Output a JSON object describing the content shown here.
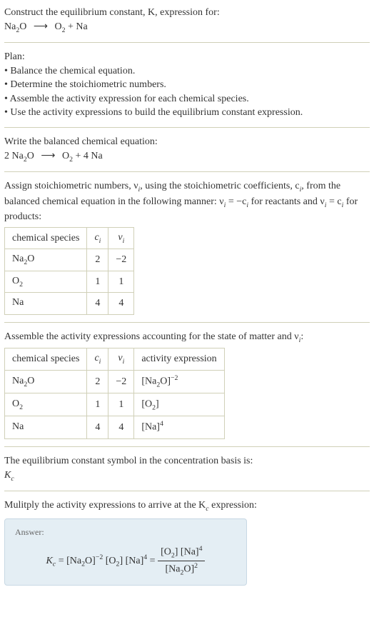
{
  "intro": {
    "line1": "Construct the equilibrium constant, K, expression for:",
    "eq_lhs": "Na",
    "eq_lhs_sub": "2",
    "eq_lhs2": "O",
    "eq_rhs1": "O",
    "eq_rhs1_sub": "2",
    "eq_rhs2": "Na"
  },
  "plan": {
    "title": "Plan:",
    "items": [
      "• Balance the chemical equation.",
      "• Determine the stoichiometric numbers.",
      "• Assemble the activity expression for each chemical species.",
      "• Use the activity expressions to build the equilibrium constant expression."
    ]
  },
  "balanced": {
    "title": "Write the balanced chemical equation:",
    "c1": "2 Na",
    "c1_sub": "2",
    "c1b": "O",
    "c2": "O",
    "c2_sub": "2",
    "c3": "4 Na"
  },
  "stoich": {
    "intro1": "Assign stoichiometric numbers, ν",
    "intro1_sub": "i",
    "intro2": ", using the stoichiometric coefficients, c",
    "intro2_sub": "i",
    "intro3": ", from the balanced chemical equation in the following manner: ν",
    "intro3_sub": "i",
    "intro4": " = −c",
    "intro4_sub": "i",
    "intro5": " for reactants and ν",
    "intro5_sub": "i",
    "intro6": " = c",
    "intro6_sub": "i",
    "intro7": " for products:",
    "headers": {
      "h1": "chemical species",
      "h2": "c",
      "h2_sub": "i",
      "h3": "ν",
      "h3_sub": "i"
    },
    "rows": [
      {
        "sp": "Na",
        "sp_sub": "2",
        "sp2": "O",
        "c": "2",
        "v": "−2"
      },
      {
        "sp": "O",
        "sp_sub": "2",
        "sp2": "",
        "c": "1",
        "v": "1"
      },
      {
        "sp": "Na",
        "sp_sub": "",
        "sp2": "",
        "c": "4",
        "v": "4"
      }
    ]
  },
  "activity": {
    "title1": "Assemble the activity expressions accounting for the state of matter and ν",
    "title1_sub": "i",
    "title2": ":",
    "headers": {
      "h1": "chemical species",
      "h2": "c",
      "h2_sub": "i",
      "h3": "ν",
      "h3_sub": "i",
      "h4": "activity expression"
    },
    "rows": [
      {
        "sp": "Na",
        "sp_sub": "2",
        "sp2": "O",
        "c": "2",
        "v": "−2",
        "act": "[Na",
        "act_sub": "2",
        "act2": "O]",
        "act_sup": "−2"
      },
      {
        "sp": "O",
        "sp_sub": "2",
        "sp2": "",
        "c": "1",
        "v": "1",
        "act": "[O",
        "act_sub": "2",
        "act2": "]",
        "act_sup": ""
      },
      {
        "sp": "Na",
        "sp_sub": "",
        "sp2": "",
        "c": "4",
        "v": "4",
        "act": "[Na]",
        "act_sub": "",
        "act2": "",
        "act_sup": "4"
      }
    ]
  },
  "symbol": {
    "line1": "The equilibrium constant symbol in the concentration basis is:",
    "line2": "K",
    "line2_sub": "c"
  },
  "final": {
    "title1": "Mulitply the activity expressions to arrive at the K",
    "title1_sub": "c",
    "title2": " expression:",
    "answer_label": "Answer:",
    "expr": {
      "k": "K",
      "k_sub": "c",
      "t1": "[Na",
      "t1_sub": "2",
      "t1b": "O]",
      "t1_sup": "−2",
      "t2": "[O",
      "t2_sub": "2",
      "t2b": "]",
      "t3": "[Na]",
      "t3_sup": "4",
      "num1": "[O",
      "num1_sub": "2",
      "num1b": "] [Na]",
      "num1_sup": "4",
      "den1": "[Na",
      "den1_sub": "2",
      "den1b": "O]",
      "den1_sup": "2"
    }
  }
}
